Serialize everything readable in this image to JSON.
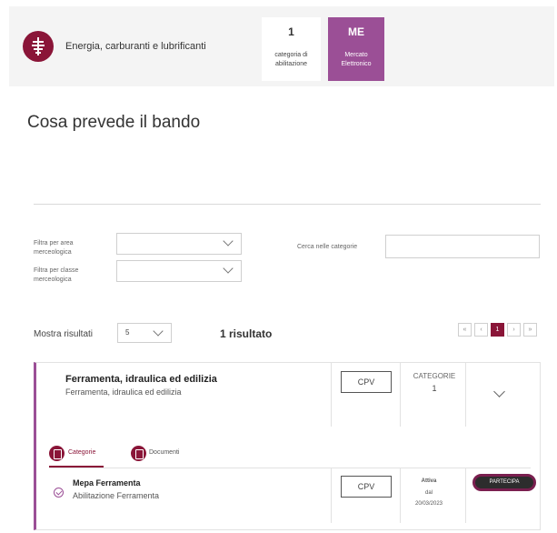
{
  "header": {
    "category_name": "Energia, carburanti e lubrificanti",
    "count_box": {
      "value": "1",
      "label_line1": "categoria di",
      "label_line2": "abilitazione"
    },
    "type_box": {
      "abbr": "ME",
      "label_line1": "Mercato",
      "label_line2": "Elettronico"
    },
    "colors": {
      "accent": "#8a1538",
      "purple": "#9b4f96"
    }
  },
  "page_title": "Cosa prevede il bando",
  "filters": {
    "area_label_line1": "Filtra per area",
    "area_label_line2": "merceologica",
    "class_label_line1": "Filtra per classe",
    "class_label_line2": "merceologica",
    "search_label": "Cerca nelle categorie",
    "area_value": "",
    "class_value": "",
    "search_value": ""
  },
  "results_bar": {
    "show_label": "Mostra risultati",
    "page_size": "5",
    "results_text": "1 risultato",
    "pagination": {
      "first": "«",
      "prev": "‹",
      "current": "1",
      "next": "›",
      "last": "»"
    }
  },
  "card": {
    "title": "Ferramenta, idraulica ed edilizia",
    "subtitle": "Ferramenta, idraulica ed edilizia",
    "cpv_label": "CPV",
    "categories_label": "CATEGORIE",
    "categories_count": "1",
    "tabs": [
      {
        "label": "Categorie",
        "icon": "categories-icon"
      },
      {
        "label": "Documenti",
        "icon": "documents-icon"
      }
    ],
    "item": {
      "title": "Mepa Ferramenta",
      "subtitle": "Abilitazione Ferramenta",
      "cpv_label": "CPV",
      "status": "Attiva",
      "status_prefix": "dal",
      "status_date": "20/03/2023",
      "action_label": "PARTECIPA"
    }
  }
}
